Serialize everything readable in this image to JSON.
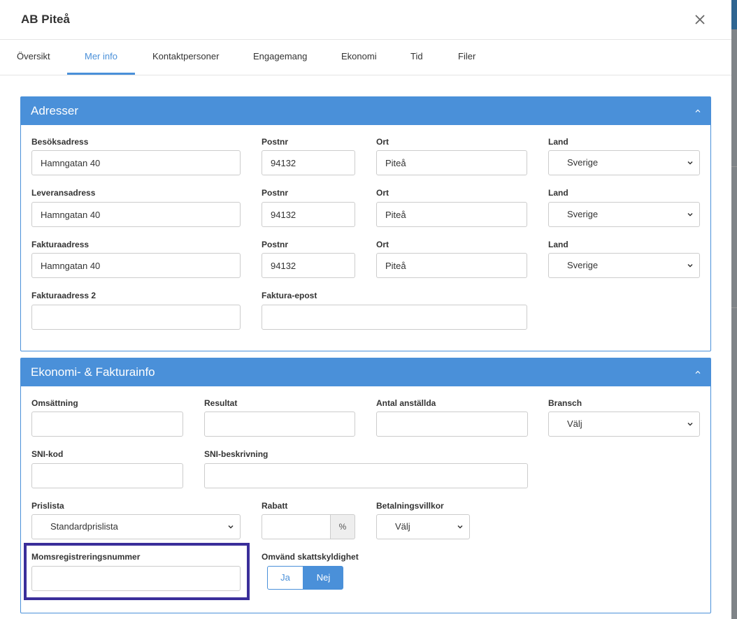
{
  "modal": {
    "title": "AB Piteå"
  },
  "tabs": [
    {
      "label": "Översikt"
    },
    {
      "label": "Mer info"
    },
    {
      "label": "Kontaktpersoner"
    },
    {
      "label": "Engagemang"
    },
    {
      "label": "Ekonomi"
    },
    {
      "label": "Tid"
    },
    {
      "label": "Filer"
    }
  ],
  "active_tab": "Mer info",
  "addresses": {
    "title": "Adresser",
    "rows": [
      {
        "street_label": "Besöksadress",
        "street": "Hamngatan 40",
        "zip_label": "Postnr",
        "zip": "94132",
        "city_label": "Ort",
        "city": "Piteå",
        "country_label": "Land",
        "country": "Sverige"
      },
      {
        "street_label": "Leveransadress",
        "street": "Hamngatan 40",
        "zip_label": "Postnr",
        "zip": "94132",
        "city_label": "Ort",
        "city": "Piteå",
        "country_label": "Land",
        "country": "Sverige"
      },
      {
        "street_label": "Fakturaadress",
        "street": "Hamngatan 40",
        "zip_label": "Postnr",
        "zip": "94132",
        "city_label": "Ort",
        "city": "Piteå",
        "country_label": "Land",
        "country": "Sverige"
      }
    ],
    "invoice_address_2_label": "Fakturaadress 2",
    "invoice_address_2": "",
    "invoice_email_label": "Faktura-epost",
    "invoice_email": ""
  },
  "economy": {
    "title": "Ekonomi- & Fakturainfo",
    "turnover_label": "Omsättning",
    "turnover": "",
    "result_label": "Resultat",
    "result": "",
    "employees_label": "Antal anställda",
    "employees": "",
    "industry_label": "Bransch",
    "industry": "Välj",
    "sni_code_label": "SNI-kod",
    "sni_code": "",
    "sni_desc_label": "SNI-beskrivning",
    "sni_desc": "",
    "pricelist_label": "Prislista",
    "pricelist": "Standardprislista",
    "discount_label": "Rabatt",
    "discount": "",
    "discount_unit": "%",
    "payment_terms_label": "Betalningsvillkor",
    "payment_terms": "Välj",
    "vat_number_label": "Momsregistreringsnummer",
    "vat_number": "",
    "reverse_charge_label": "Omvänd skattskyldighet",
    "reverse_charge_yes": "Ja",
    "reverse_charge_no": "Nej",
    "reverse_charge_selected": "Nej"
  },
  "colors": {
    "accent": "#4a90d9",
    "highlight": "#3a2e9a"
  },
  "icons": {
    "close": "close-icon",
    "collapse": "chevron-up-icon",
    "dropdown": "chevron-down-icon"
  }
}
